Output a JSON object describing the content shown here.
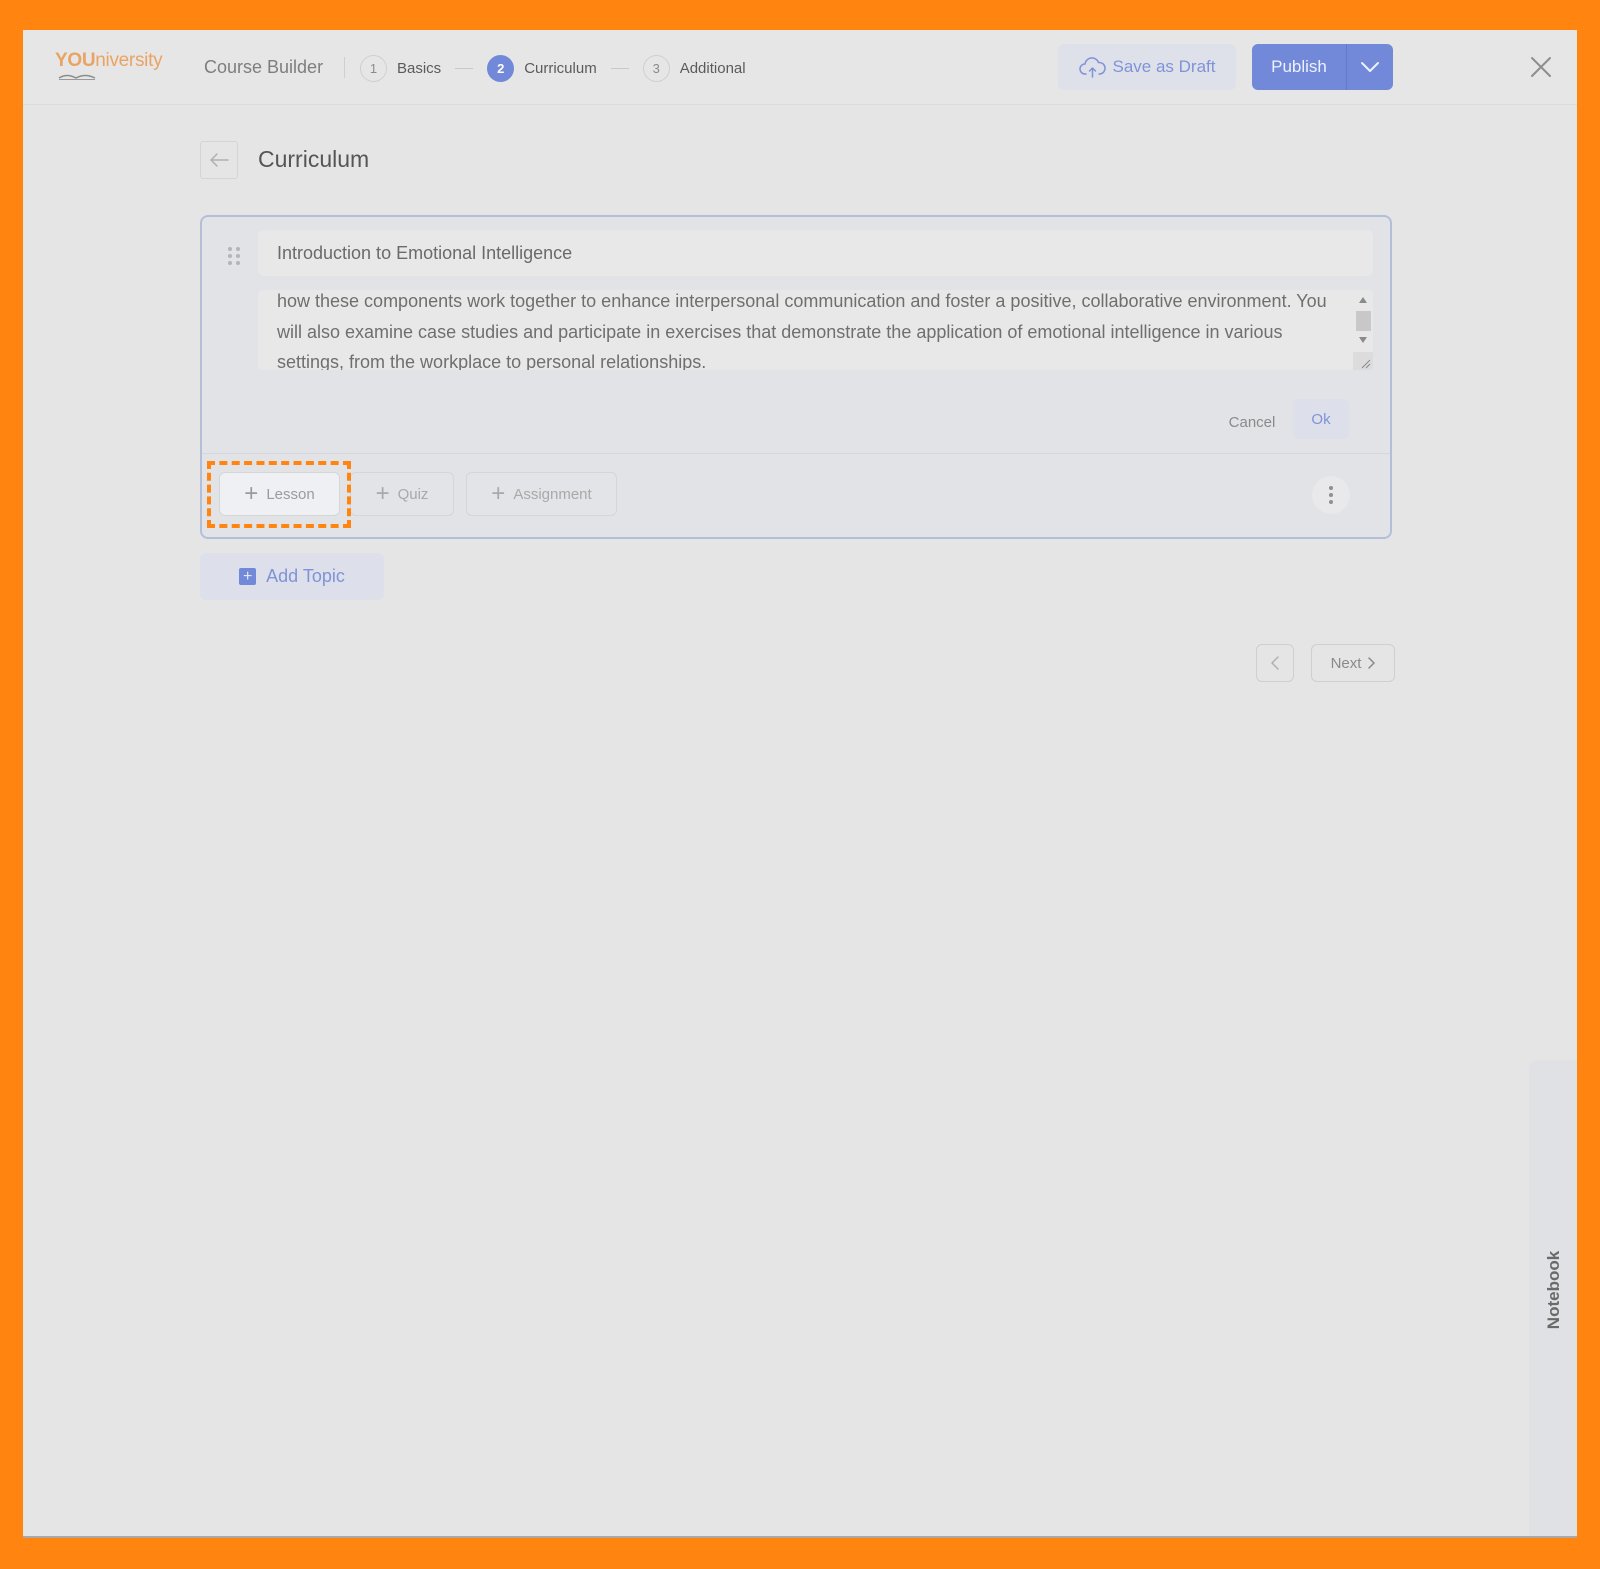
{
  "header": {
    "logo": {
      "bold": "YOU",
      "rest": "niversity"
    },
    "app_title": "Course Builder",
    "steps": [
      {
        "number": "1",
        "label": "Basics",
        "active": false
      },
      {
        "number": "2",
        "label": "Curriculum",
        "active": true
      },
      {
        "number": "3",
        "label": "Additional",
        "active": false
      }
    ],
    "save_draft_label": "Save as Draft",
    "publish_label": "Publish"
  },
  "page": {
    "title": "Curriculum"
  },
  "topic": {
    "title_value": "Introduction to Emotional Intelligence",
    "description_value": "how these components work together to enhance interpersonal communication and foster a positive, collaborative environment. You will also examine case studies and participate in exercises that demonstrate the application of emotional intelligence in various settings, from the workplace to personal relationships.",
    "cancel_label": "Cancel",
    "ok_label": "Ok",
    "add_buttons": [
      {
        "label": "Lesson"
      },
      {
        "label": "Quiz"
      },
      {
        "label": "Assignment"
      }
    ]
  },
  "add_topic_label": "Add Topic",
  "pagination": {
    "next_label": "Next"
  },
  "notebook_label": "Notebook",
  "colors": {
    "accent": "#7189d8",
    "highlight": "#ff8410",
    "logo": "#e9a465"
  }
}
